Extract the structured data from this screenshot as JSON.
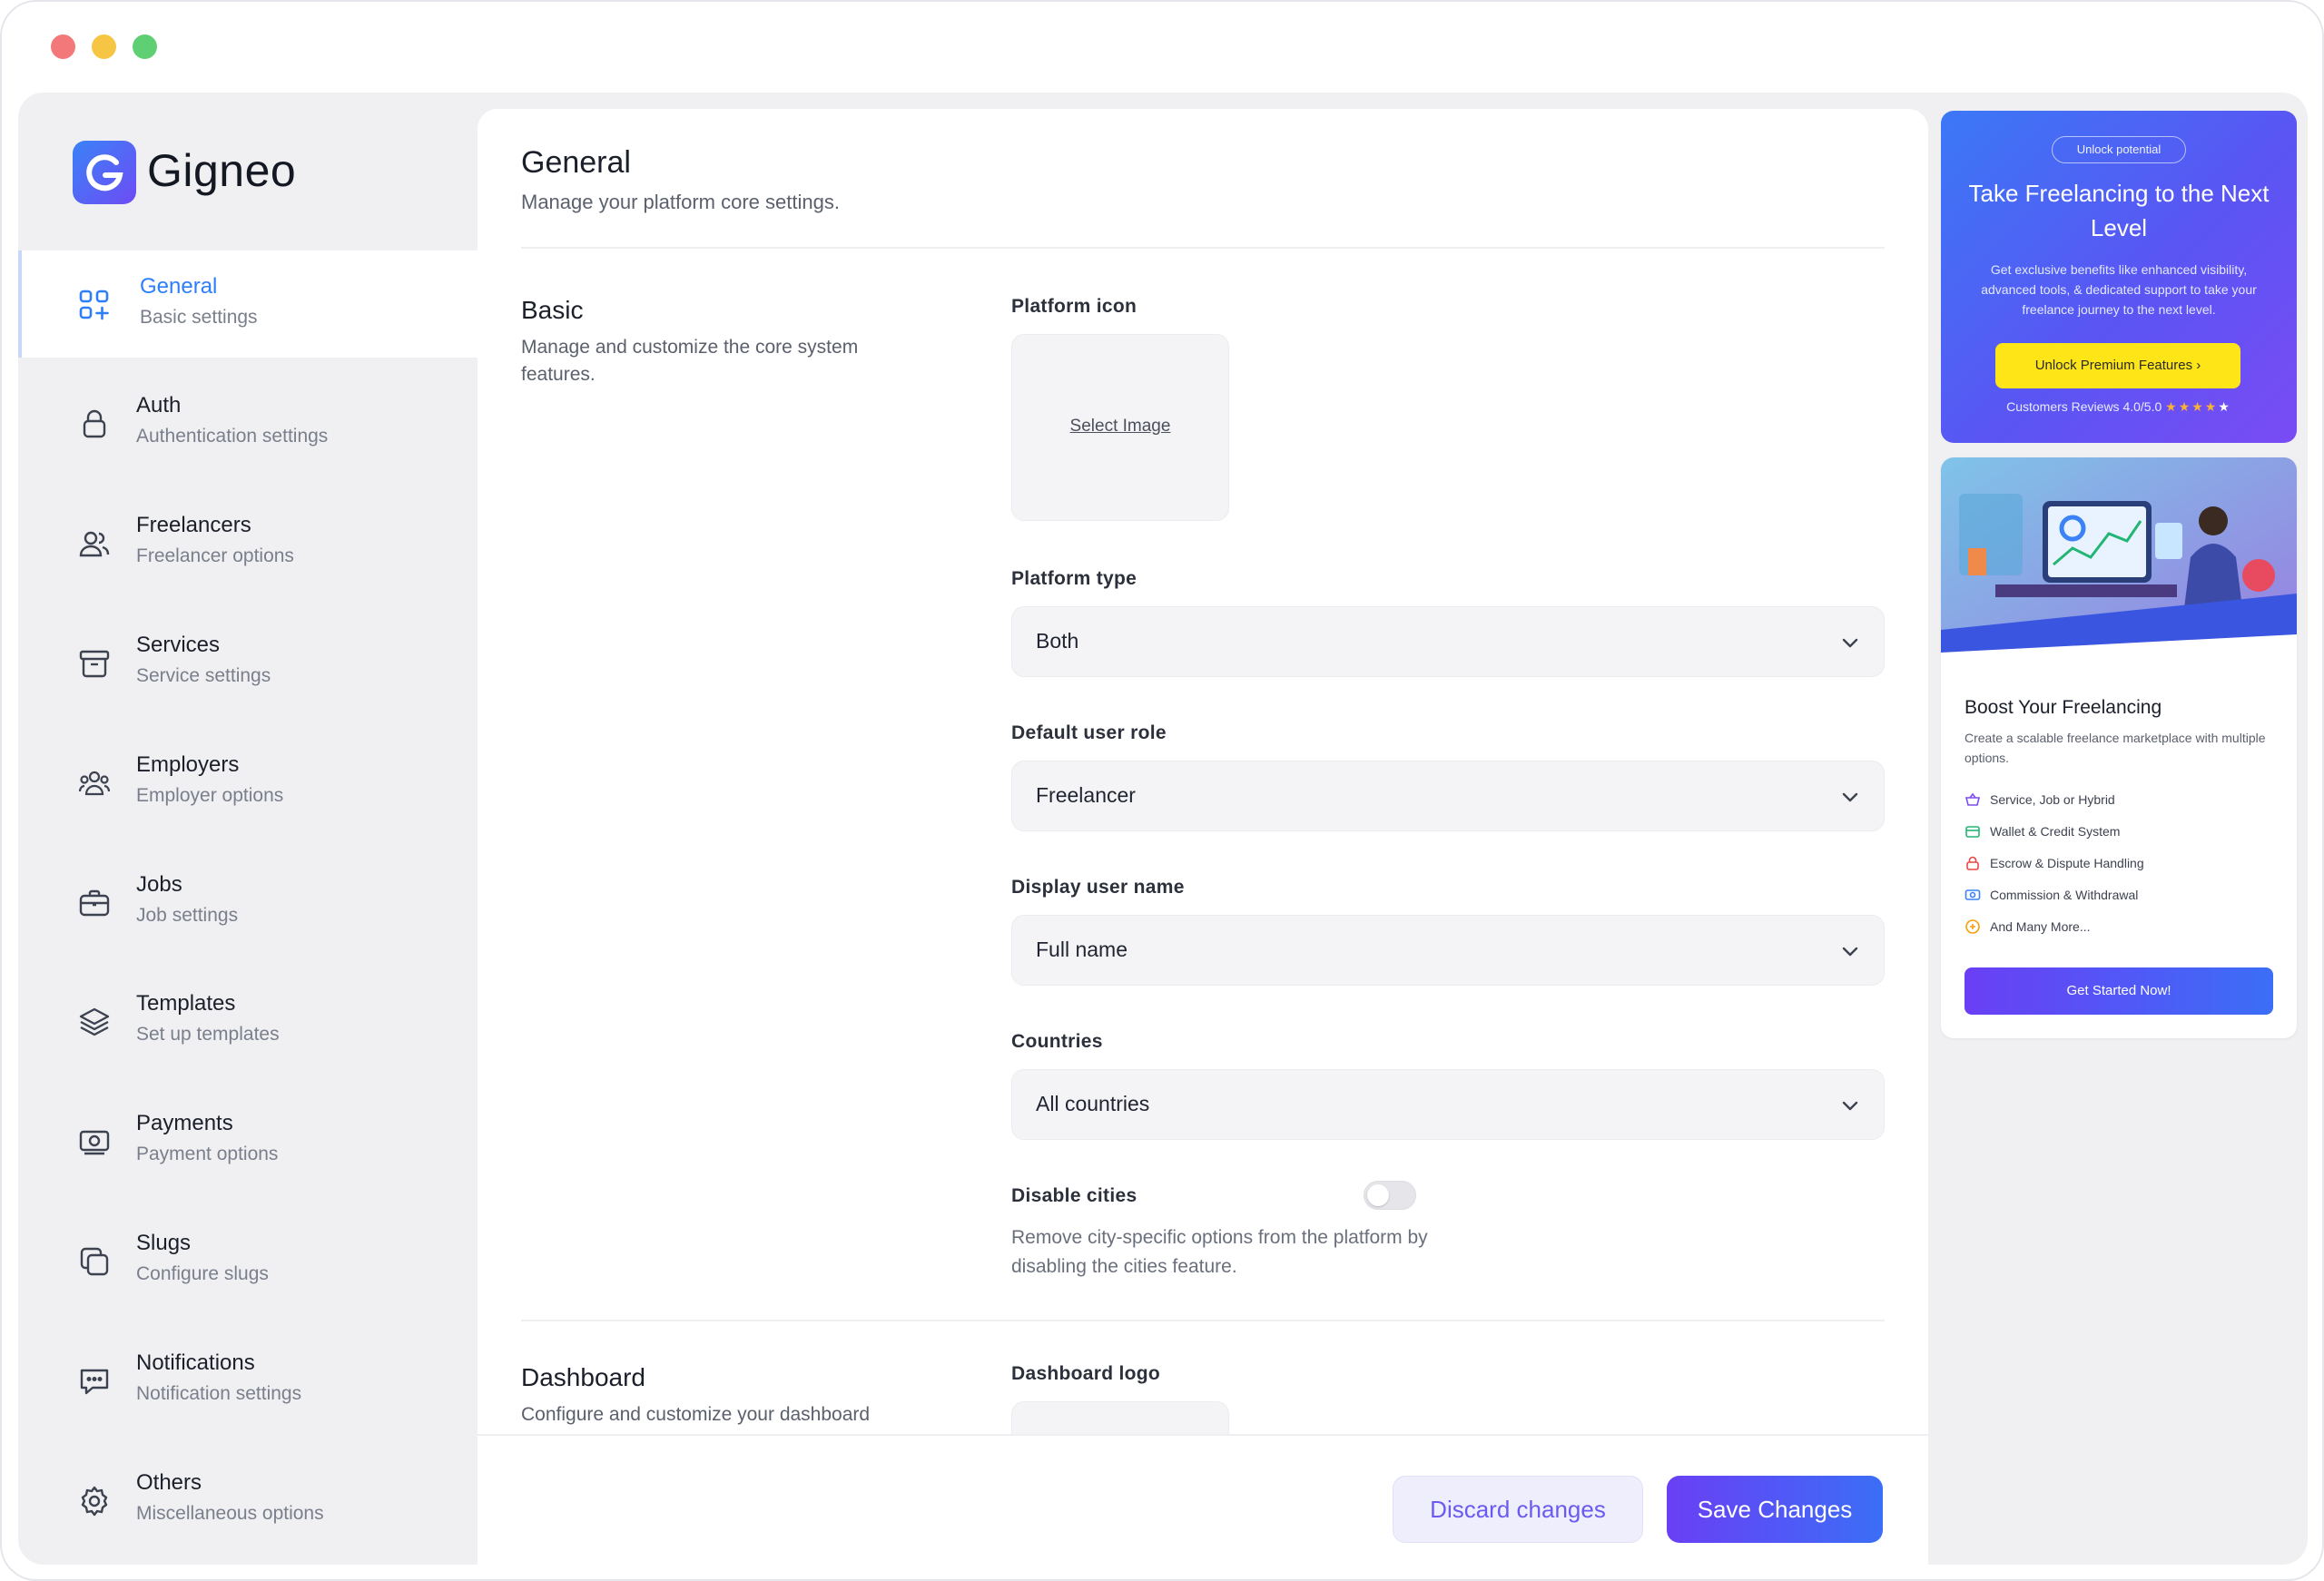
{
  "app": {
    "brand_name": "Gigneo"
  },
  "sidebar": {
    "items": [
      {
        "label": "General",
        "sub": "Basic settings",
        "icon": "grid-plus-icon",
        "active": true
      },
      {
        "label": "Auth",
        "sub": "Authentication settings",
        "icon": "lock-icon"
      },
      {
        "label": "Freelancers",
        "sub": "Freelancer options",
        "icon": "users-icon"
      },
      {
        "label": "Services",
        "sub": "Service settings",
        "icon": "archive-icon"
      },
      {
        "label": "Employers",
        "sub": "Employer options",
        "icon": "team-icon"
      },
      {
        "label": "Jobs",
        "sub": "Job settings",
        "icon": "briefcase-icon"
      },
      {
        "label": "Templates",
        "sub": "Set up templates",
        "icon": "layers-icon"
      },
      {
        "label": "Payments",
        "sub": "Payment options",
        "icon": "payment-icon"
      },
      {
        "label": "Slugs",
        "sub": "Configure slugs",
        "icon": "copy-icon"
      },
      {
        "label": "Notifications",
        "sub": "Notification settings",
        "icon": "chat-icon"
      },
      {
        "label": "Others",
        "sub": "Miscellaneous options",
        "icon": "gear-icon"
      }
    ]
  },
  "main": {
    "title": "General",
    "subtitle": "Manage your platform core settings.",
    "basic": {
      "title": "Basic",
      "description": "Manage and customize the core system features.",
      "platform_icon_label": "Platform icon",
      "select_image": "Select Image",
      "platform_type_label": "Platform type",
      "platform_type_value": "Both",
      "default_role_label": "Default user role",
      "default_role_value": "Freelancer",
      "display_name_label": "Display user name",
      "display_name_value": "Full name",
      "countries_label": "Countries",
      "countries_value": "All countries",
      "disable_cities_label": "Disable cities",
      "disable_cities_on": false,
      "disable_cities_help": "Remove city-specific options from the platform by disabling the cities feature."
    },
    "dashboard": {
      "title": "Dashboard",
      "description": "Configure and customize your dashboard",
      "logo_label": "Dashboard logo"
    },
    "footer": {
      "discard_label": "Discard changes",
      "save_label": "Save Changes"
    }
  },
  "promo_upgrade": {
    "badge": "Unlock potential",
    "title": "Take Freelancing to the Next Level",
    "text": "Get exclusive benefits like enhanced visibility, advanced tools, & dedicated support to take your freelance journey to the next level.",
    "button": "Unlock Premium Features",
    "reviews": "Customers Reviews 4.0/5.0",
    "rating": 4
  },
  "promo_boost": {
    "title": "Boost Your Freelancing",
    "text": "Create a scalable freelance marketplace with multiple options.",
    "features": [
      {
        "label": "Service, Job or Hybrid",
        "icon": "basket-icon",
        "color": "#7c4df5"
      },
      {
        "label": "Wallet & Credit System",
        "icon": "wallet-icon",
        "color": "#22b573"
      },
      {
        "label": "Escrow & Dispute Handling",
        "icon": "lock-icon",
        "color": "#ef4444"
      },
      {
        "label": "Commission & Withdrawal",
        "icon": "cash-icon",
        "color": "#3b82f6"
      },
      {
        "label": "And Many More...",
        "icon": "plus-circle-icon",
        "color": "#f59e0b"
      }
    ],
    "button": "Get Started Now!"
  },
  "colors": {
    "accent": "#2d7ff9",
    "primary_button_start": "#6a3ff5",
    "primary_button_end": "#3b6ef6",
    "premium_button": "#fde518"
  }
}
